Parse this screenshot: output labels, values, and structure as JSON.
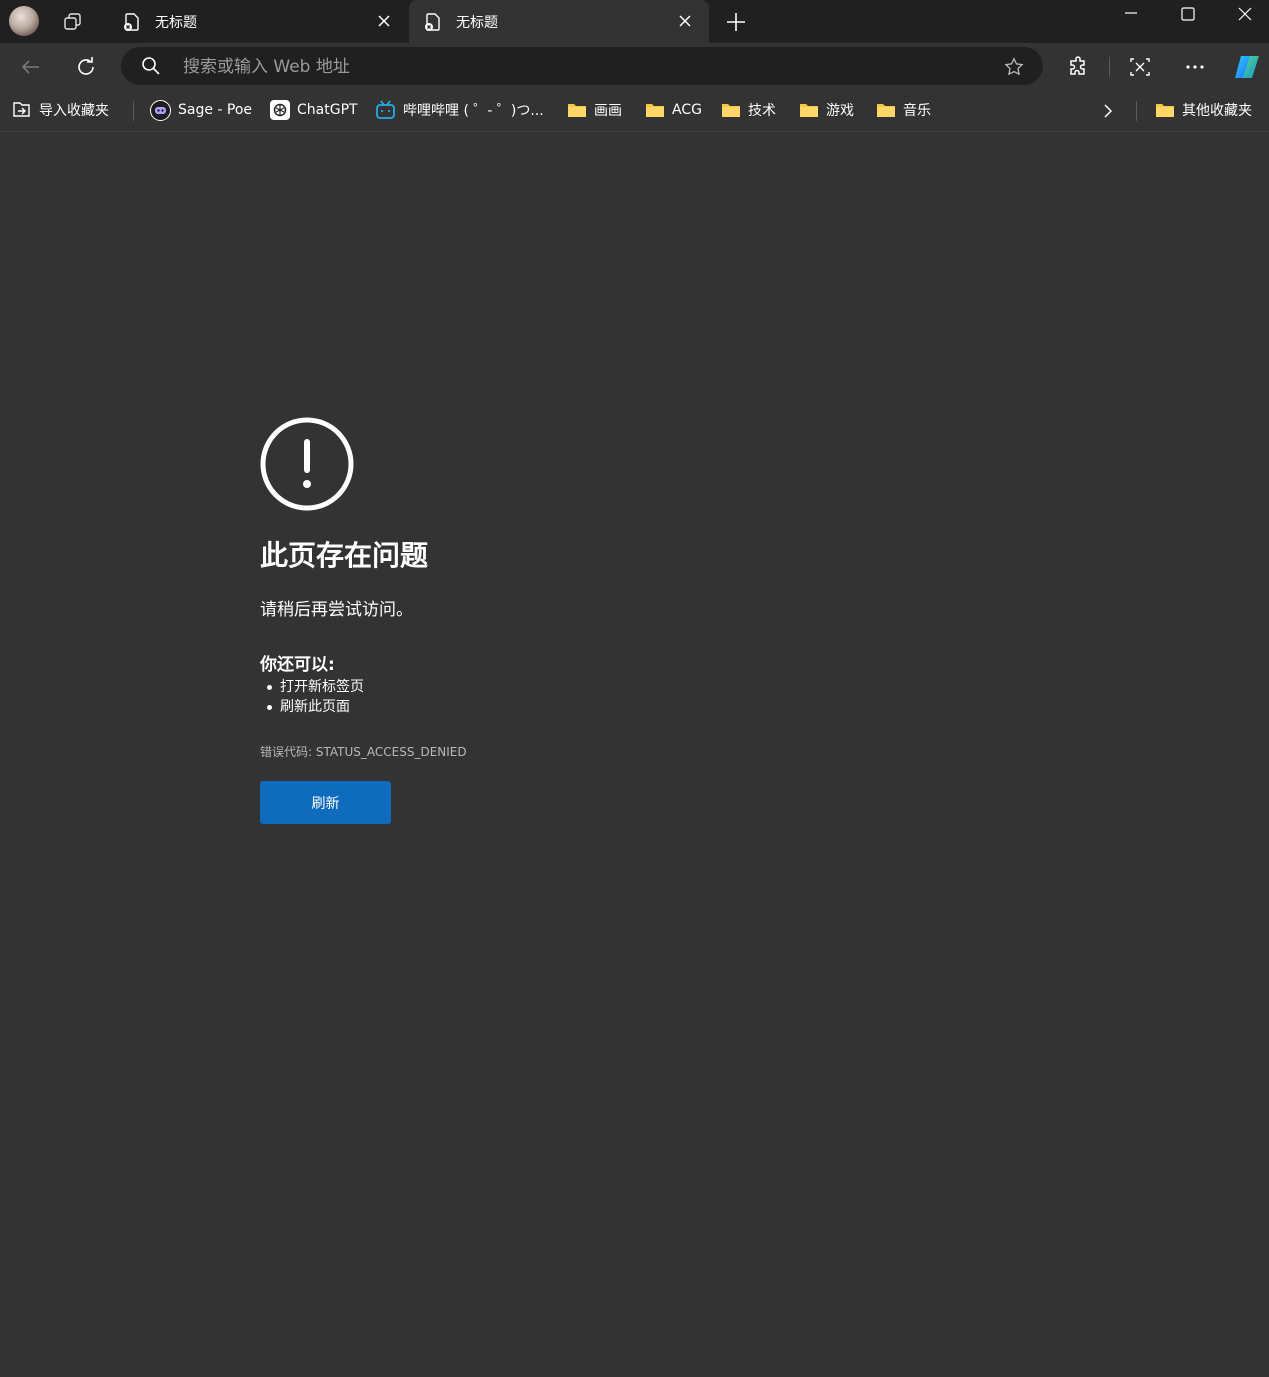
{
  "tabs": [
    {
      "title": "无标题"
    },
    {
      "title": "无标题"
    }
  ],
  "address_bar": {
    "placeholder": "搜索或输入 Web 地址",
    "value": ""
  },
  "bookmarks": [
    {
      "label": "导入收藏夹",
      "icon": "import-icon"
    },
    {
      "label": "Sage - Poe",
      "icon": "poe-icon"
    },
    {
      "label": "ChatGPT",
      "icon": "chatgpt-icon"
    },
    {
      "label": "哔哩哔哩 ( ゜- ゜)つ...",
      "icon": "bilibili-icon"
    },
    {
      "label": "画画",
      "icon": "folder-icon"
    },
    {
      "label": "ACG",
      "icon": "folder-icon"
    },
    {
      "label": "技术",
      "icon": "folder-icon"
    },
    {
      "label": "游戏",
      "icon": "folder-icon"
    },
    {
      "label": "音乐",
      "icon": "folder-icon"
    },
    {
      "label": "其他收藏夹",
      "icon": "folder-icon"
    }
  ],
  "error": {
    "title": "此页存在问题",
    "subtitle": "请稍后再尝试访问。",
    "suggestions_heading": "你还可以:",
    "suggestions": [
      "打开新标签页",
      "刷新此页面"
    ],
    "code_label": "错误代码: STATUS_ACCESS_DENIED",
    "refresh_button": "刷新"
  },
  "colors": {
    "accent": "#0f6cbd",
    "folder": "#f4c842",
    "background": "#333333",
    "titlebar": "#202020"
  }
}
